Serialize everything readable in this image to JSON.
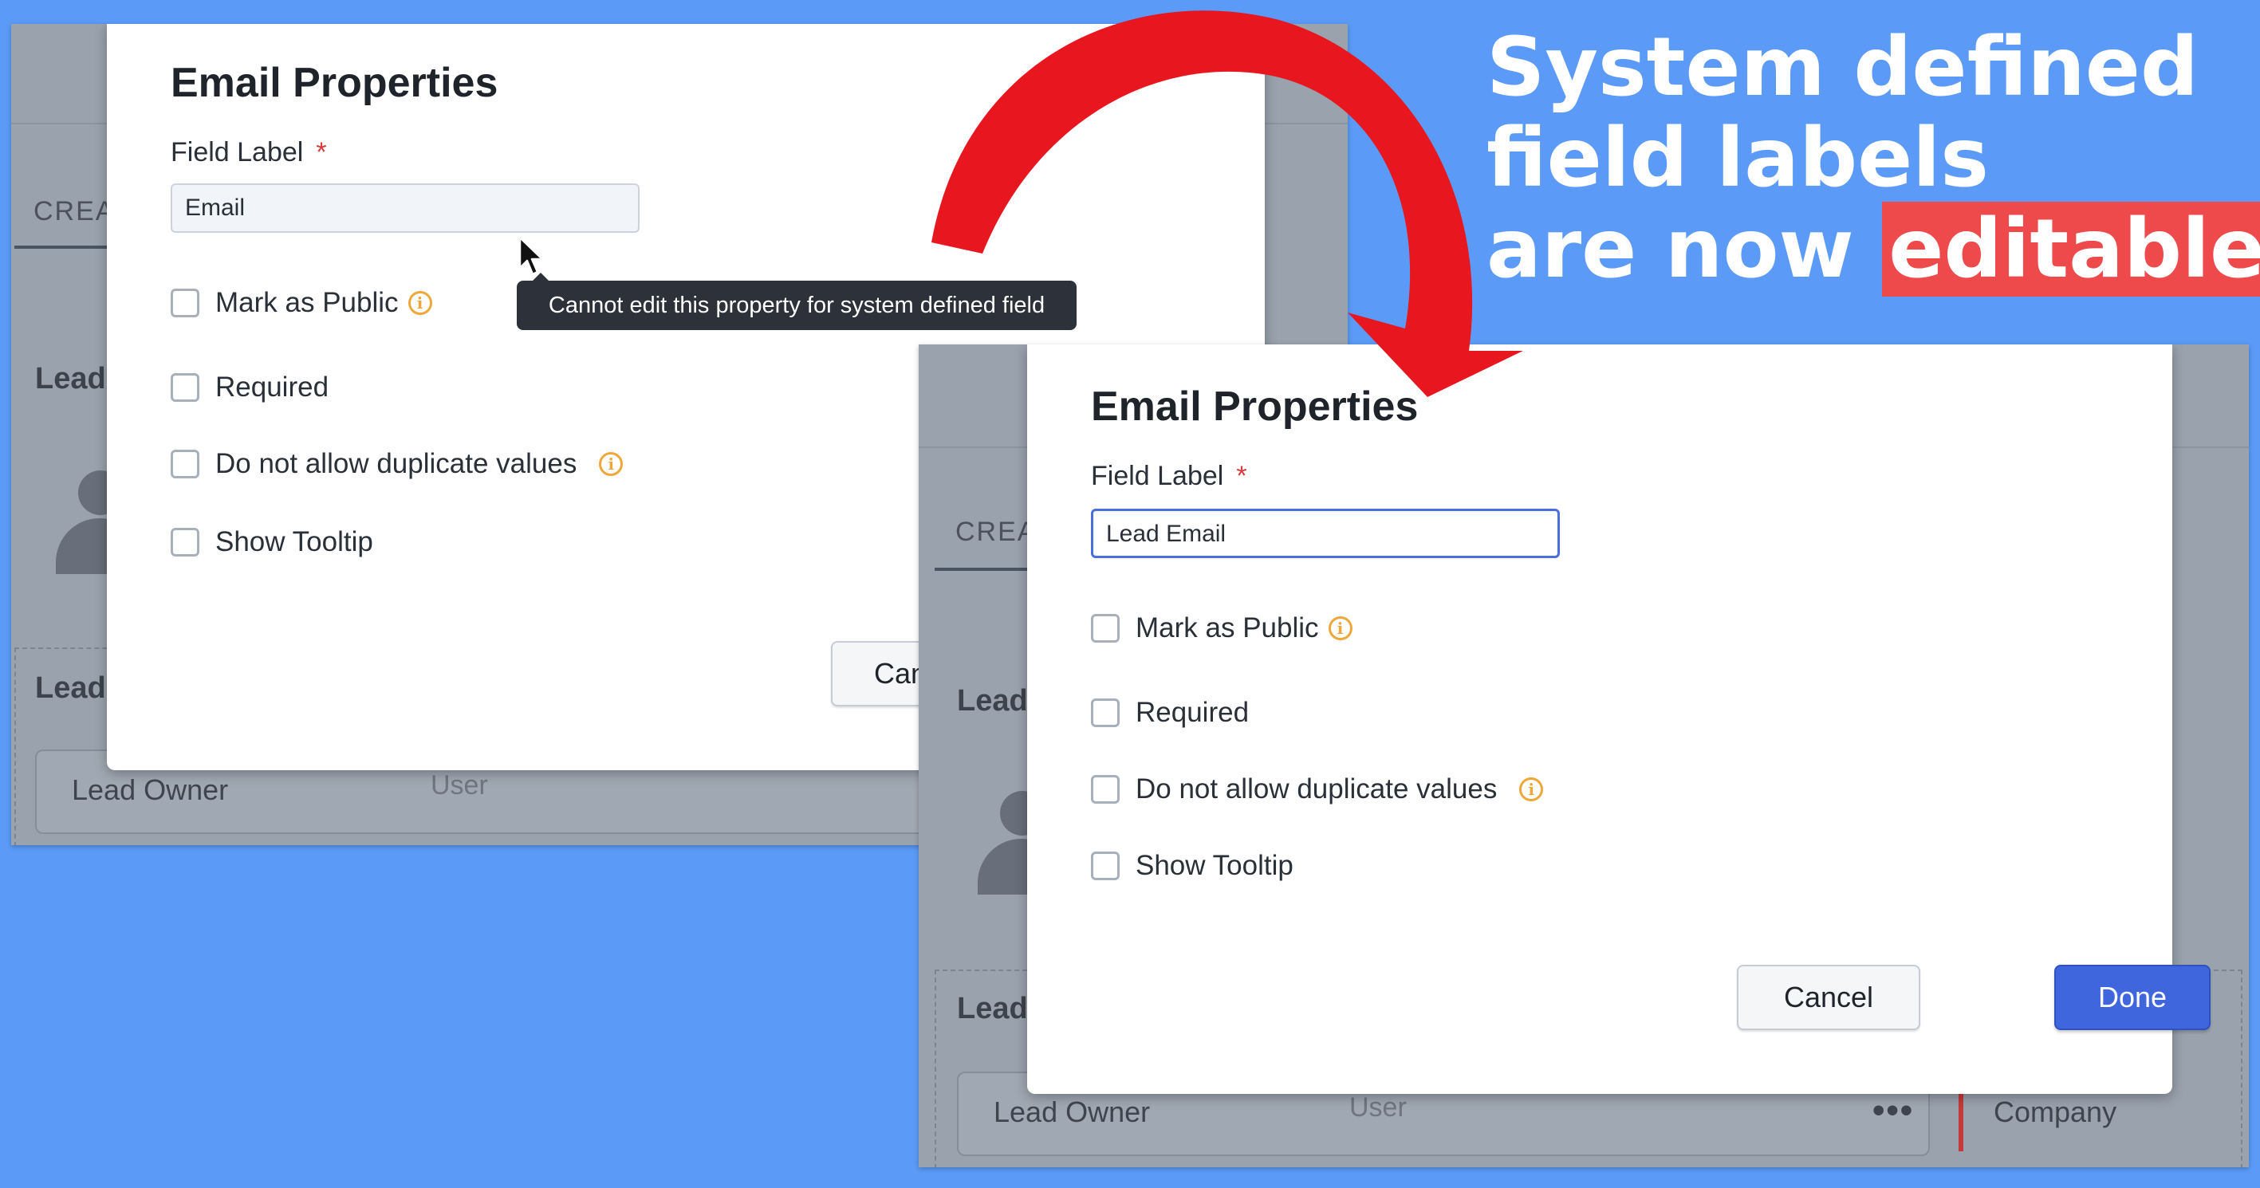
{
  "headline": {
    "line1": "System defined",
    "line2": "field labels",
    "line3_prefix": "are now ",
    "line3_highlight": "editable"
  },
  "background_ui": {
    "tab_label": "CREA",
    "section_label": "Lead",
    "field_row_label": "Lead Owner",
    "field_row_type": "User",
    "more_icon": "more-dots",
    "next_field": "Company"
  },
  "before_dialog": {
    "title": "Email Properties",
    "field_label": "Field Label",
    "required_mark": "*",
    "input_value": "Email",
    "tooltip": "Cannot edit this property for system defined field",
    "options": [
      {
        "label": "Mark as Public",
        "info": true
      },
      {
        "label": "Required",
        "info": false
      },
      {
        "label": "Do not allow duplicate values",
        "info": true
      },
      {
        "label": "Show Tooltip",
        "info": false
      }
    ],
    "cancel_label": "Canc"
  },
  "after_dialog": {
    "title": "Email Properties",
    "field_label": "Field Label",
    "required_mark": "*",
    "input_value": "Lead Email",
    "options": [
      {
        "label": "Mark as Public",
        "info": true
      },
      {
        "label": "Required",
        "info": false
      },
      {
        "label": "Do not allow duplicate values",
        "info": true
      },
      {
        "label": "Show Tooltip",
        "info": false
      }
    ],
    "cancel_label": "Cancel",
    "done_label": "Done"
  },
  "colors": {
    "page_bg": "#5b9bf7",
    "highlight": "#ee4a4c",
    "arrow": "#e8161e",
    "primary_button": "#3f66dd",
    "info_icon": "#f0a73a",
    "required": "#d9383a"
  },
  "info_glyph": "i"
}
